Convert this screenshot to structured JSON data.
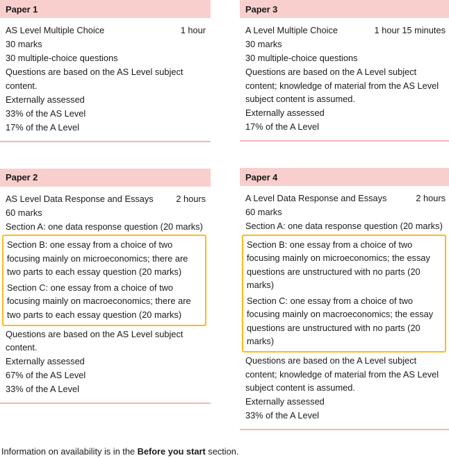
{
  "papers": {
    "paper1": {
      "title": "Paper 1",
      "name": "AS Level Multiple Choice",
      "duration": "1 hour",
      "lines": [
        "30 marks",
        "30 multiple-choice questions",
        "Questions are based on the AS Level subject content.",
        "Externally assessed",
        "33% of the AS Level",
        "17% of the A Level"
      ]
    },
    "paper2": {
      "title": "Paper 2",
      "name": "AS Level Data Response and Essays",
      "duration": "2 hours",
      "lines_before": [
        "60 marks",
        "Section A: one data response question (20 marks)"
      ],
      "highlight": [
        "Section B: one essay from a choice of two focusing mainly on microeconomics; there are two parts to each essay question (20 marks)",
        "Section C: one essay from a choice of two focusing mainly on macroeconomics; there are two parts to each essay question (20 marks)"
      ],
      "lines_after": [
        "Questions are based on the AS Level subject content.",
        "Externally assessed",
        "67% of the AS Level",
        "33% of the A Level"
      ]
    },
    "paper3": {
      "title": "Paper 3",
      "name": "A Level Multiple Choice",
      "duration": "1 hour 15 minutes",
      "lines": [
        "30 marks",
        "30 multiple-choice questions",
        "Questions are based on the A Level subject content; knowledge of material from the AS Level subject content is assumed.",
        "Externally assessed",
        "17% of the A Level"
      ]
    },
    "paper4": {
      "title": "Paper 4",
      "name": "A Level Data Response and Essays",
      "duration": "2 hours",
      "lines_before": [
        "60 marks",
        "Section A: one data response question (20 marks)"
      ],
      "highlight": [
        "Section B: one essay from a choice of two focusing mainly on microeconomics; the essay questions are unstructured with no parts (20 marks)",
        "Section C: one essay from a choice of two focusing mainly on macroeconomics; the essay questions are unstructured with no parts (20 marks)"
      ],
      "lines_after": [
        "Questions are based on the A Level subject content; knowledge of material from the AS Level subject content is assumed.",
        "Externally assessed",
        "33% of the A Level"
      ]
    }
  },
  "footer": {
    "prefix": "Information on availability is in the ",
    "emphasis": "Before you start",
    "suffix": " section."
  },
  "colors": {
    "header_pink": "#f9cfcd",
    "divider_pink": "#f4b6b4",
    "highlight_yellow": "#ffb81c",
    "text": "#1a1a1a"
  }
}
